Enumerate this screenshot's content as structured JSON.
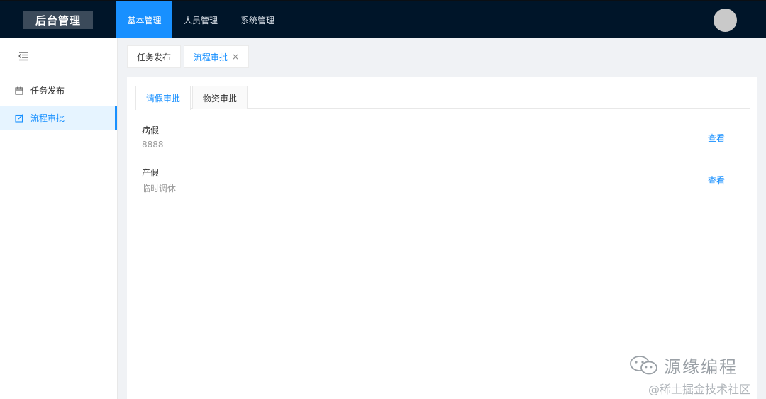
{
  "header": {
    "logo": "后台管理",
    "nav": [
      {
        "label": "基本管理"
      },
      {
        "label": "人员管理"
      },
      {
        "label": "系统管理"
      }
    ]
  },
  "sidebar": {
    "items": [
      {
        "label": "任务发布",
        "icon": "calendar-icon"
      },
      {
        "label": "流程审批",
        "icon": "edit-icon"
      }
    ]
  },
  "page_tabs": [
    {
      "label": "任务发布"
    },
    {
      "label": "流程审批",
      "close": "×"
    }
  ],
  "inner_tabs": [
    {
      "label": "请假审批"
    },
    {
      "label": "物资审批"
    }
  ],
  "list": [
    {
      "title": "病假",
      "desc": "8888",
      "action": "查看"
    },
    {
      "title": "产假",
      "desc": "临时调休",
      "action": "查看"
    }
  ],
  "watermark": {
    "main": "源缘编程",
    "sub": "@稀土掘金技术社区"
  },
  "colors": {
    "header_bg": "#001529",
    "accent": "#1890ff",
    "page_bg": "#f0f2f5"
  }
}
